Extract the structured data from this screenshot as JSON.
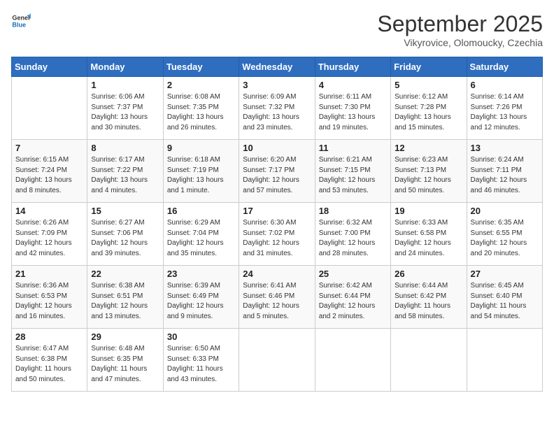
{
  "header": {
    "logo_general": "General",
    "logo_blue": "Blue",
    "month_title": "September 2025",
    "location": "Vikyrovice, Olomoucky, Czechia"
  },
  "days_of_week": [
    "Sunday",
    "Monday",
    "Tuesday",
    "Wednesday",
    "Thursday",
    "Friday",
    "Saturday"
  ],
  "weeks": [
    [
      {
        "num": "",
        "info": ""
      },
      {
        "num": "1",
        "info": "Sunrise: 6:06 AM\nSunset: 7:37 PM\nDaylight: 13 hours\nand 30 minutes."
      },
      {
        "num": "2",
        "info": "Sunrise: 6:08 AM\nSunset: 7:35 PM\nDaylight: 13 hours\nand 26 minutes."
      },
      {
        "num": "3",
        "info": "Sunrise: 6:09 AM\nSunset: 7:32 PM\nDaylight: 13 hours\nand 23 minutes."
      },
      {
        "num": "4",
        "info": "Sunrise: 6:11 AM\nSunset: 7:30 PM\nDaylight: 13 hours\nand 19 minutes."
      },
      {
        "num": "5",
        "info": "Sunrise: 6:12 AM\nSunset: 7:28 PM\nDaylight: 13 hours\nand 15 minutes."
      },
      {
        "num": "6",
        "info": "Sunrise: 6:14 AM\nSunset: 7:26 PM\nDaylight: 13 hours\nand 12 minutes."
      }
    ],
    [
      {
        "num": "7",
        "info": "Sunrise: 6:15 AM\nSunset: 7:24 PM\nDaylight: 13 hours\nand 8 minutes."
      },
      {
        "num": "8",
        "info": "Sunrise: 6:17 AM\nSunset: 7:22 PM\nDaylight: 13 hours\nand 4 minutes."
      },
      {
        "num": "9",
        "info": "Sunrise: 6:18 AM\nSunset: 7:19 PM\nDaylight: 13 hours\nand 1 minute."
      },
      {
        "num": "10",
        "info": "Sunrise: 6:20 AM\nSunset: 7:17 PM\nDaylight: 12 hours\nand 57 minutes."
      },
      {
        "num": "11",
        "info": "Sunrise: 6:21 AM\nSunset: 7:15 PM\nDaylight: 12 hours\nand 53 minutes."
      },
      {
        "num": "12",
        "info": "Sunrise: 6:23 AM\nSunset: 7:13 PM\nDaylight: 12 hours\nand 50 minutes."
      },
      {
        "num": "13",
        "info": "Sunrise: 6:24 AM\nSunset: 7:11 PM\nDaylight: 12 hours\nand 46 minutes."
      }
    ],
    [
      {
        "num": "14",
        "info": "Sunrise: 6:26 AM\nSunset: 7:09 PM\nDaylight: 12 hours\nand 42 minutes."
      },
      {
        "num": "15",
        "info": "Sunrise: 6:27 AM\nSunset: 7:06 PM\nDaylight: 12 hours\nand 39 minutes."
      },
      {
        "num": "16",
        "info": "Sunrise: 6:29 AM\nSunset: 7:04 PM\nDaylight: 12 hours\nand 35 minutes."
      },
      {
        "num": "17",
        "info": "Sunrise: 6:30 AM\nSunset: 7:02 PM\nDaylight: 12 hours\nand 31 minutes."
      },
      {
        "num": "18",
        "info": "Sunrise: 6:32 AM\nSunset: 7:00 PM\nDaylight: 12 hours\nand 28 minutes."
      },
      {
        "num": "19",
        "info": "Sunrise: 6:33 AM\nSunset: 6:58 PM\nDaylight: 12 hours\nand 24 minutes."
      },
      {
        "num": "20",
        "info": "Sunrise: 6:35 AM\nSunset: 6:55 PM\nDaylight: 12 hours\nand 20 minutes."
      }
    ],
    [
      {
        "num": "21",
        "info": "Sunrise: 6:36 AM\nSunset: 6:53 PM\nDaylight: 12 hours\nand 16 minutes."
      },
      {
        "num": "22",
        "info": "Sunrise: 6:38 AM\nSunset: 6:51 PM\nDaylight: 12 hours\nand 13 minutes."
      },
      {
        "num": "23",
        "info": "Sunrise: 6:39 AM\nSunset: 6:49 PM\nDaylight: 12 hours\nand 9 minutes."
      },
      {
        "num": "24",
        "info": "Sunrise: 6:41 AM\nSunset: 6:46 PM\nDaylight: 12 hours\nand 5 minutes."
      },
      {
        "num": "25",
        "info": "Sunrise: 6:42 AM\nSunset: 6:44 PM\nDaylight: 12 hours\nand 2 minutes."
      },
      {
        "num": "26",
        "info": "Sunrise: 6:44 AM\nSunset: 6:42 PM\nDaylight: 11 hours\nand 58 minutes."
      },
      {
        "num": "27",
        "info": "Sunrise: 6:45 AM\nSunset: 6:40 PM\nDaylight: 11 hours\nand 54 minutes."
      }
    ],
    [
      {
        "num": "28",
        "info": "Sunrise: 6:47 AM\nSunset: 6:38 PM\nDaylight: 11 hours\nand 50 minutes."
      },
      {
        "num": "29",
        "info": "Sunrise: 6:48 AM\nSunset: 6:35 PM\nDaylight: 11 hours\nand 47 minutes."
      },
      {
        "num": "30",
        "info": "Sunrise: 6:50 AM\nSunset: 6:33 PM\nDaylight: 11 hours\nand 43 minutes."
      },
      {
        "num": "",
        "info": ""
      },
      {
        "num": "",
        "info": ""
      },
      {
        "num": "",
        "info": ""
      },
      {
        "num": "",
        "info": ""
      }
    ]
  ]
}
